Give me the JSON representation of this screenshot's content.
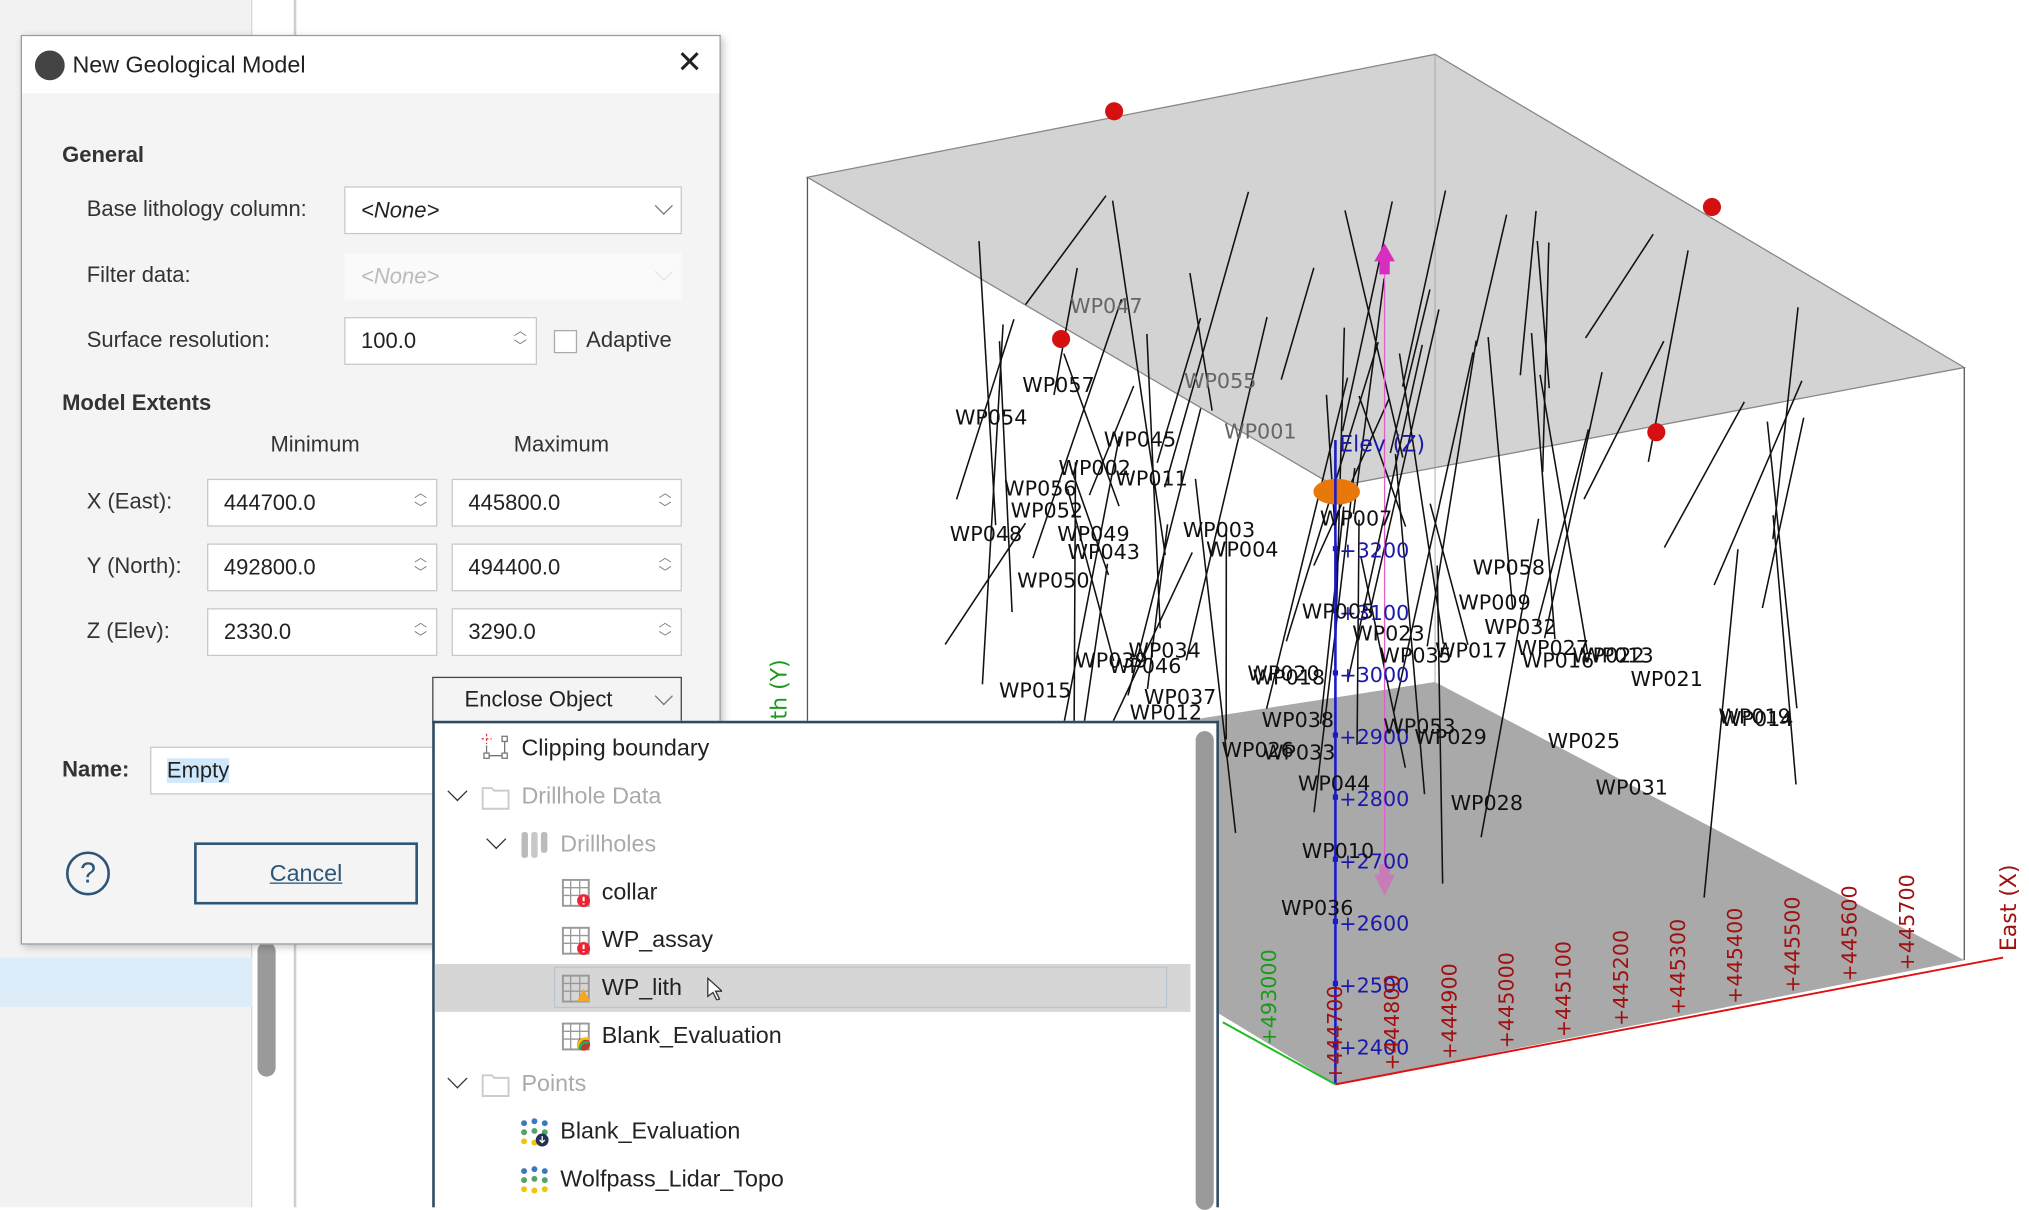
{
  "dialog": {
    "title": "New Geological Model",
    "general_heading": "General",
    "base_lithology_label": "Base lithology column:",
    "base_lithology_value": "<None>",
    "filter_label": "Filter data:",
    "filter_value": "<None>",
    "resolution_label": "Surface resolution:",
    "resolution_value": "100.0",
    "adaptive_label": "Adaptive",
    "adaptive_checked": false,
    "extents_heading": "Model Extents",
    "min_header": "Minimum",
    "max_header": "Maximum",
    "rows": [
      {
        "label": "X (East):",
        "min": "444700.0",
        "max": "445800.0"
      },
      {
        "label": "Y (North):",
        "min": "492800.0",
        "max": "494400.0"
      },
      {
        "label": "Z (Elev):",
        "min": "2330.0",
        "max": "3290.0"
      }
    ],
    "enclose_label": "Enclose Object",
    "name_label": "Name:",
    "name_value": "Empty",
    "cancel_label": "Cancel",
    "help_label": "?"
  },
  "dropdown": {
    "items": [
      {
        "label": "Clipping boundary",
        "icon": "clipping-boundary-icon",
        "enabled": true
      },
      {
        "label": "Drillhole Data",
        "icon": "folder-icon",
        "enabled": false,
        "expanded": true
      },
      {
        "label": "Drillholes",
        "icon": "drillholes-icon",
        "enabled": false,
        "expanded": true
      },
      {
        "label": "collar",
        "icon": "table-error-icon",
        "enabled": true
      },
      {
        "label": "WP_assay",
        "icon": "table-error-icon",
        "enabled": true
      },
      {
        "label": "WP_lith",
        "icon": "table-warning-icon",
        "enabled": true,
        "selected": true
      },
      {
        "label": "Blank_Evaluation",
        "icon": "table-evaluation-icon",
        "enabled": true
      },
      {
        "label": "Points",
        "icon": "folder-icon",
        "enabled": false,
        "expanded": true
      },
      {
        "label": "Blank_Evaluation",
        "icon": "points-download-icon",
        "enabled": true
      },
      {
        "label": "Wolfpass_Lidar_Topo",
        "icon": "points-icon",
        "enabled": true
      }
    ]
  },
  "scene": {
    "z_axis_label": "Elev (Z)",
    "x_axis_label": "East (X)",
    "y_axis_label": "th (Y)",
    "z_ticks": [
      "+3200",
      "+3100",
      "+3000",
      "+2900",
      "+2800",
      "+2700",
      "+2600",
      "+2500",
      "+2400"
    ],
    "x_ticks": [
      "+444700",
      "+444800",
      "+444900",
      "+445000",
      "+445100",
      "+445200",
      "+445300",
      "+445400",
      "+445500",
      "+445600",
      "+445700"
    ],
    "y_ticks": [
      "+493000"
    ],
    "wells": [
      "WP047",
      "WP057",
      "WP055",
      "WP054",
      "WP045",
      "WP001",
      "WP002",
      "WP011",
      "WP056",
      "WP052",
      "WP048",
      "WP049",
      "WP003",
      "WP043",
      "WP004",
      "WP007",
      "WP050",
      "WP058",
      "WP005",
      "WP009",
      "WP023",
      "WP032",
      "WP034",
      "WP035",
      "WP017",
      "WP027",
      "WP016",
      "WP022",
      "WP013",
      "WP039",
      "WP046",
      "WP020",
      "WP018",
      "WP021",
      "WP015",
      "WP037",
      "WP012",
      "WP038",
      "WP053",
      "WP029",
      "WP019",
      "WP014",
      "WP026",
      "WP033",
      "WP025",
      "WP044",
      "WP031",
      "WP028",
      "WP010",
      "WP036"
    ],
    "colors": {
      "z_axis": "#1a1acc",
      "x_axis": "#e01010",
      "y_axis": "#22bb22",
      "plane": "#d3d3d3",
      "plane_bottom": "#a9a9a9",
      "pink": "#e060c8"
    }
  }
}
